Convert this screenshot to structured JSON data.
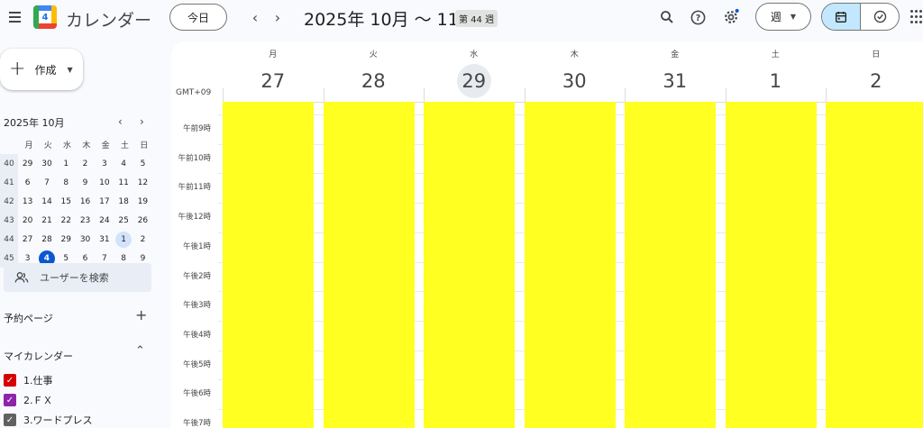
{
  "header": {
    "app_title": "カレンダー",
    "logo_day": "4",
    "today_label": "今日",
    "range_title": "2025年 10月 〜 11月",
    "week_badge": "第 44 週",
    "view_label": "週"
  },
  "sidebar": {
    "create_label": "作成",
    "mini_title": "2025年 10月",
    "weekdays": [
      "月",
      "火",
      "水",
      "木",
      "金",
      "土",
      "日"
    ],
    "weeks": [
      {
        "wk": "40",
        "days": [
          "29",
          "30",
          "1",
          "2",
          "3",
          "4",
          "5"
        ]
      },
      {
        "wk": "41",
        "days": [
          "6",
          "7",
          "8",
          "9",
          "10",
          "11",
          "12"
        ]
      },
      {
        "wk": "42",
        "days": [
          "13",
          "14",
          "15",
          "16",
          "17",
          "18",
          "19"
        ]
      },
      {
        "wk": "43",
        "days": [
          "20",
          "21",
          "22",
          "23",
          "24",
          "25",
          "26"
        ]
      },
      {
        "wk": "44",
        "days": [
          "27",
          "28",
          "29",
          "30",
          "31",
          "1",
          "2"
        ]
      },
      {
        "wk": "45",
        "days": [
          "3",
          "4",
          "5",
          "6",
          "7",
          "8",
          "9"
        ]
      }
    ],
    "search_users_placeholder": "ユーザーを検索",
    "booking_pages_label": "予約ページ",
    "my_calendars_label": "マイカレンダー",
    "calendars": [
      {
        "name": "1.仕事",
        "color": "#d50000"
      },
      {
        "name": "2.ＦＸ",
        "color": "#8e24aa"
      },
      {
        "name": "3.ワードプレス",
        "color": "#616161"
      }
    ]
  },
  "grid": {
    "timezone": "GMT+09",
    "days": [
      {
        "dow": "月",
        "num": "27"
      },
      {
        "dow": "火",
        "num": "28"
      },
      {
        "dow": "水",
        "num": "29",
        "current": true
      },
      {
        "dow": "木",
        "num": "30"
      },
      {
        "dow": "金",
        "num": "31"
      },
      {
        "dow": "土",
        "num": "1"
      },
      {
        "dow": "日",
        "num": "2"
      }
    ],
    "hours": [
      "午前9時",
      "午前10時",
      "午前11時",
      "午後12時",
      "午後1時",
      "午後2時",
      "午後3時",
      "午後4時",
      "午後5時",
      "午後6時",
      "午後7時"
    ],
    "event_color": "#ffff22"
  }
}
